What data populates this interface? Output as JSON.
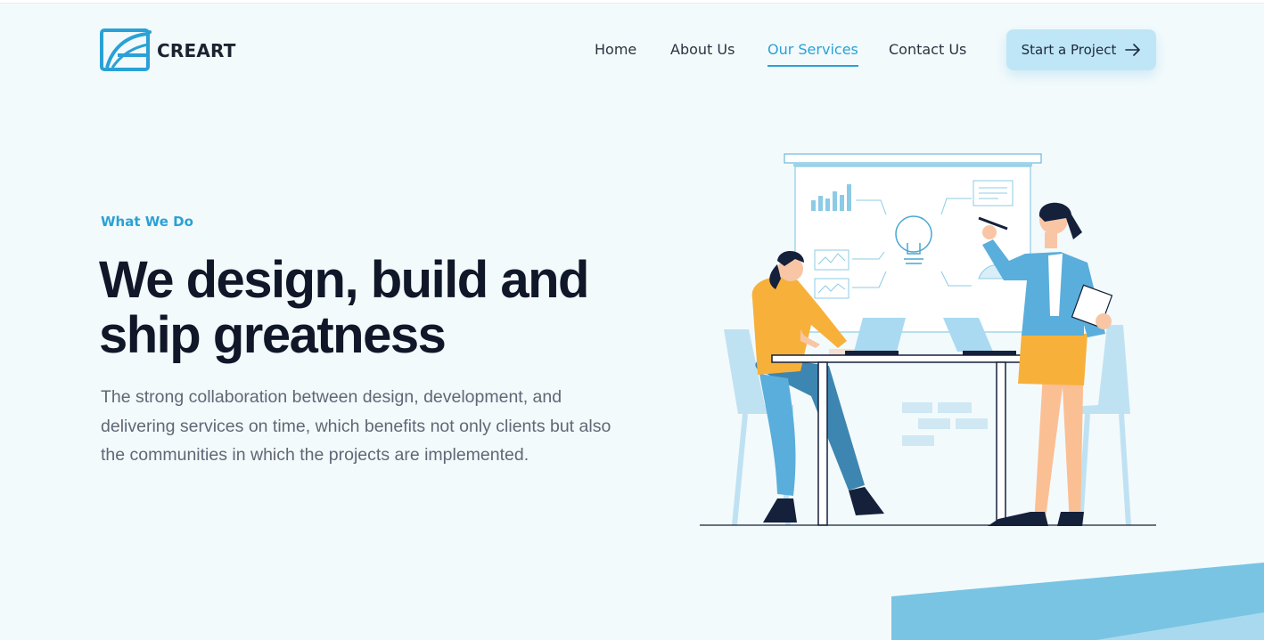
{
  "brand": {
    "name": "CREART",
    "logo_icon": "creart-logo-icon",
    "accent": "#2aa1d6"
  },
  "nav": {
    "items": [
      {
        "label": "Home",
        "active": false
      },
      {
        "label": "About Us",
        "active": false
      },
      {
        "label": "Our Services",
        "active": true
      },
      {
        "label": "Contact Us",
        "active": false
      }
    ],
    "cta_label": "Start a Project",
    "cta_icon": "arrow-right-icon"
  },
  "hero": {
    "eyebrow": "What We Do",
    "headline_line1": "We design, build and",
    "headline_line2": "ship greatness",
    "description": "The strong collaboration between design, development, and delivering services on time, which benefits not only clients but also the communities in which the projects are implemented."
  },
  "colors": {
    "background": "#f3fafc",
    "heading": "#0f1728",
    "body_text": "#5f6875",
    "cta_bg": "#bfe6f6",
    "wedge": "#79c4e3"
  }
}
